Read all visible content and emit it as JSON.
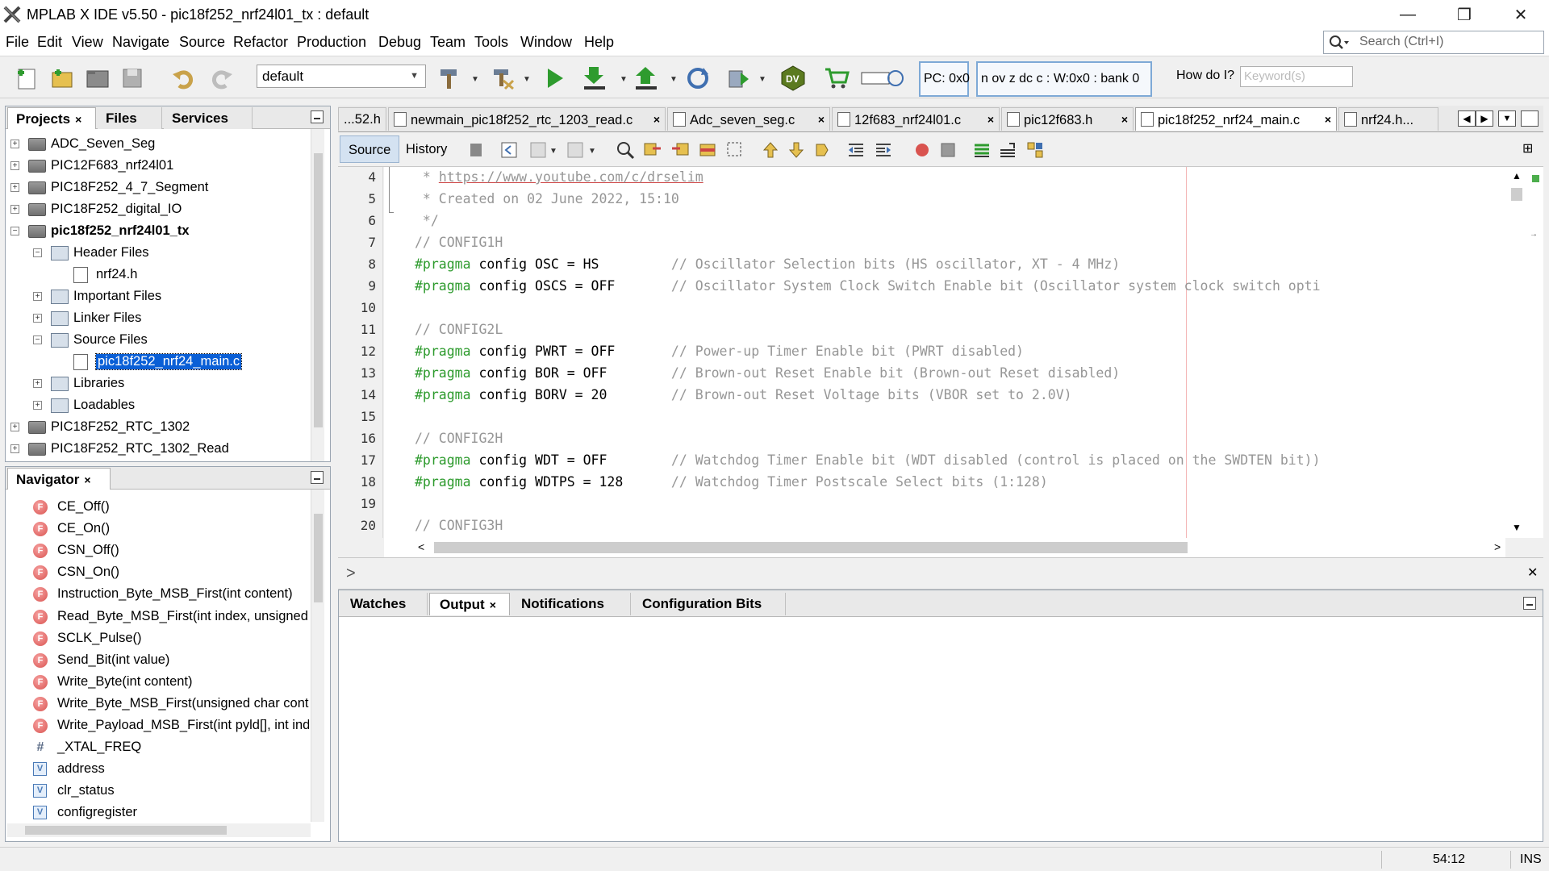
{
  "window": {
    "title": "MPLAB X IDE v5.50 - pic18f252_nrf24l01_tx : default",
    "minimize": "—",
    "restore": "❐",
    "close": "✕"
  },
  "menu": {
    "items": [
      "File",
      "Edit",
      "View",
      "Navigate",
      "Source",
      "Refactor",
      "Production",
      "Debug",
      "Team",
      "Tools",
      "Window",
      "Help"
    ],
    "search_placeholder": "Search (Ctrl+I)"
  },
  "toolbar": {
    "configuration": "default",
    "pc_label": "PC: 0x0",
    "status_label": "n ov z dc c  : W:0x0 : bank 0",
    "howdo_label": "How do I?",
    "keyword_placeholder": "Keyword(s)"
  },
  "projects_panel": {
    "tabs": [
      "Projects",
      "Files",
      "Services"
    ],
    "active_tab": "Projects",
    "close_glyph": "×",
    "tree": [
      {
        "label": "ADC_Seven_Seg",
        "type": "project",
        "level": 0,
        "expander": "+"
      },
      {
        "label": "PIC12F683_nrf24l01",
        "type": "project",
        "level": 0,
        "expander": "+"
      },
      {
        "label": "PIC18F252_4_7_Segment",
        "type": "project",
        "level": 0,
        "expander": "+"
      },
      {
        "label": "PIC18F252_digital_IO",
        "type": "project",
        "level": 0,
        "expander": "+"
      },
      {
        "label": "pic18f252_nrf24l01_tx",
        "type": "project",
        "level": 0,
        "expander": "−",
        "bold": true
      },
      {
        "label": "Header Files",
        "type": "folder",
        "level": 1,
        "expander": "−"
      },
      {
        "label": "nrf24.h",
        "type": "file",
        "level": 2,
        "expander": ""
      },
      {
        "label": "Important Files",
        "type": "folder",
        "level": 1,
        "expander": "+"
      },
      {
        "label": "Linker Files",
        "type": "folder",
        "level": 1,
        "expander": "+"
      },
      {
        "label": "Source Files",
        "type": "folder",
        "level": 1,
        "expander": "−"
      },
      {
        "label": "pic18f252_nrf24_main.c",
        "type": "file",
        "level": 2,
        "expander": "",
        "selected": true
      },
      {
        "label": "Libraries",
        "type": "folder",
        "level": 1,
        "expander": "+"
      },
      {
        "label": "Loadables",
        "type": "folder",
        "level": 1,
        "expander": "+"
      },
      {
        "label": "PIC18F252_RTC_1302",
        "type": "project",
        "level": 0,
        "expander": "+"
      },
      {
        "label": "PIC18F252_RTC_1302_Read",
        "type": "project",
        "level": 0,
        "expander": "+"
      }
    ]
  },
  "navigator_panel": {
    "title": "Navigator",
    "items": [
      {
        "label": "CE_Off()",
        "kind": "function"
      },
      {
        "label": "CE_On()",
        "kind": "function"
      },
      {
        "label": "CSN_Off()",
        "kind": "function"
      },
      {
        "label": "CSN_On()",
        "kind": "function"
      },
      {
        "label": "Instruction_Byte_MSB_First(int content)",
        "kind": "function"
      },
      {
        "label": "Read_Byte_MSB_First(int index, unsigned c",
        "kind": "function"
      },
      {
        "label": "SCLK_Pulse()",
        "kind": "function"
      },
      {
        "label": "Send_Bit(int value)",
        "kind": "function"
      },
      {
        "label": "Write_Byte(int content)",
        "kind": "function"
      },
      {
        "label": "Write_Byte_MSB_First(unsigned char conte",
        "kind": "function"
      },
      {
        "label": "Write_Payload_MSB_First(int pyld[], int ind",
        "kind": "function"
      },
      {
        "label": "_XTAL_FREQ",
        "kind": "macro"
      },
      {
        "label": "address",
        "kind": "variable"
      },
      {
        "label": "clr_status",
        "kind": "variable"
      },
      {
        "label": "configregister",
        "kind": "variable"
      }
    ],
    "glyph_function": "F",
    "glyph_variable": "V",
    "glyph_macro": "#"
  },
  "editor": {
    "tabs": [
      {
        "label": "...52.h",
        "active": false
      },
      {
        "label": "newmain_pic18f252_rtc_1203_read.c",
        "active": false
      },
      {
        "label": "Adc_seven_seg.c",
        "active": false
      },
      {
        "label": "12f683_nrf24l01.c",
        "active": false
      },
      {
        "label": "pic12f683.h",
        "active": false
      },
      {
        "label": "pic18f252_nrf24_main.c",
        "active": true
      },
      {
        "label": "nrf24.h...",
        "active": false
      }
    ],
    "tab_close": "×",
    "source_label": "Source",
    "history_label": "History",
    "lines": [
      {
        "n": "4",
        "segments": [
          {
            "t": " * ",
            "c": "cmt"
          },
          {
            "t": "https://www.youtube.com/c/drselim",
            "c": "link"
          }
        ]
      },
      {
        "n": "5",
        "segments": [
          {
            "t": " * Created on 02 June 2022, 15:10",
            "c": "cmt"
          }
        ]
      },
      {
        "n": "6",
        "segments": [
          {
            "t": " */",
            "c": "cmt"
          }
        ]
      },
      {
        "n": "7",
        "segments": [
          {
            "t": "// CONFIG1H",
            "c": "cmt"
          }
        ]
      },
      {
        "n": "8",
        "segments": [
          {
            "t": "#pragma",
            "c": "kw"
          },
          {
            "t": " config OSC = HS         ",
            "c": ""
          },
          {
            "t": "// Oscillator Selection bits (HS oscillator, XT - 4 MHz)",
            "c": "cmt"
          }
        ]
      },
      {
        "n": "9",
        "segments": [
          {
            "t": "#pragma",
            "c": "kw"
          },
          {
            "t": " config OSCS = OFF       ",
            "c": ""
          },
          {
            "t": "// Oscillator System Clock Switch Enable bit (Oscillator system clock switch opti",
            "c": "cmt"
          }
        ]
      },
      {
        "n": "10",
        "segments": []
      },
      {
        "n": "11",
        "segments": [
          {
            "t": "// CONFIG2L",
            "c": "cmt"
          }
        ]
      },
      {
        "n": "12",
        "segments": [
          {
            "t": "#pragma",
            "c": "kw"
          },
          {
            "t": " config PWRT = OFF       ",
            "c": ""
          },
          {
            "t": "// Power-up Timer Enable bit (PWRT disabled)",
            "c": "cmt"
          }
        ]
      },
      {
        "n": "13",
        "segments": [
          {
            "t": "#pragma",
            "c": "kw"
          },
          {
            "t": " config BOR = OFF        ",
            "c": ""
          },
          {
            "t": "// Brown-out Reset Enable bit (Brown-out Reset disabled)",
            "c": "cmt"
          }
        ]
      },
      {
        "n": "14",
        "segments": [
          {
            "t": "#pragma",
            "c": "kw"
          },
          {
            "t": " config BORV = 20        ",
            "c": ""
          },
          {
            "t": "// Brown-out Reset Voltage bits (VBOR set to 2.0V)",
            "c": "cmt"
          }
        ]
      },
      {
        "n": "15",
        "segments": []
      },
      {
        "n": "16",
        "segments": [
          {
            "t": "// CONFIG2H",
            "c": "cmt"
          }
        ]
      },
      {
        "n": "17",
        "segments": [
          {
            "t": "#pragma",
            "c": "kw"
          },
          {
            "t": " config WDT = OFF        ",
            "c": ""
          },
          {
            "t": "// Watchdog Timer Enable bit (WDT disabled (control is placed on the SWDTEN bit))",
            "c": "cmt"
          }
        ]
      },
      {
        "n": "18",
        "segments": [
          {
            "t": "#pragma",
            "c": "kw"
          },
          {
            "t": " config WDTPS = 128      ",
            "c": ""
          },
          {
            "t": "// Watchdog Timer Postscale Select bits (1:128)",
            "c": "cmt"
          }
        ]
      },
      {
        "n": "19",
        "segments": []
      },
      {
        "n": "20",
        "segments": [
          {
            "t": "// CONFIG3H",
            "c": "cmt"
          }
        ]
      }
    ]
  },
  "bottom_panel": {
    "tabs": [
      "Watches",
      "Output",
      "Notifications",
      "Configuration Bits"
    ],
    "active_tab": "Output",
    "close_glyph": "×"
  },
  "status": {
    "position": "54:12",
    "mode": "INS"
  },
  "colors": {
    "accent": "#0a5fd6",
    "selection": "#0a5fd6",
    "keyword": "#2e9b2e",
    "comment": "#969696",
    "border": "#9aa5b1"
  }
}
